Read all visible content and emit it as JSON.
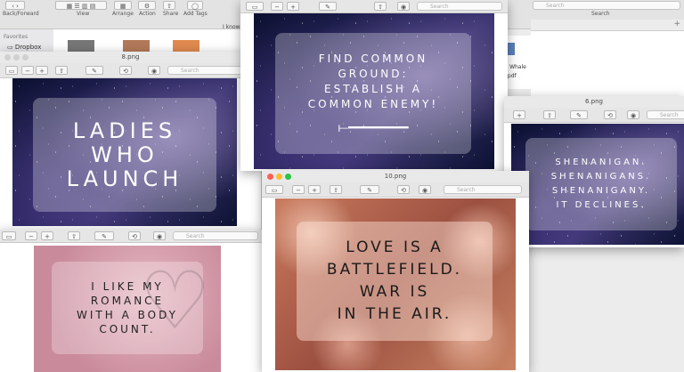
{
  "finder": {
    "toolbar_labels": [
      "Back/Forward",
      "View",
      "Arrange",
      "Action",
      "Share",
      "Add Tags",
      "Search"
    ],
    "search_placeholder": "Search",
    "sidebar": {
      "section": "Favorites",
      "item": "Dropbox"
    },
    "path_fragment": "I know",
    "file_labels": [
      "- Whale",
      ".pdf"
    ]
  },
  "windows": [
    {
      "id": "8",
      "title": "8.png",
      "search": "Search",
      "quote": "LADIES\nWHO\nLAUNCH",
      "text_color": "#ffffff"
    },
    {
      "id": "top",
      "title": "",
      "search": "Search",
      "quote": "FIND COMMON\nGROUND:\nESTABLISH A\nCOMMON ENEMY!",
      "text_color": "#ffffff"
    },
    {
      "id": "6",
      "title": "6.png",
      "search": "Search",
      "quote": "SHENANIGAN.\nSHENANIGANS.\nSHENANIGANY.\nIT DECLINES.",
      "text_color": "#ffffff"
    },
    {
      "id": "bl",
      "title": "",
      "search": "Search",
      "quote": "I LIKE MY\nROMANCE\nWITH A BODY\nCOUNT.",
      "text_color": "#222222"
    },
    {
      "id": "10",
      "title": "10.png",
      "search": "Search",
      "quote": "LOVE IS A\nBATTLEFIELD.\nWAR IS\nIN THE AIR.",
      "text_color": "#1a1a1a"
    }
  ],
  "icons": {
    "traffic_red": "#ff5f57",
    "traffic_yellow": "#febc2e",
    "traffic_green": "#28c840"
  }
}
